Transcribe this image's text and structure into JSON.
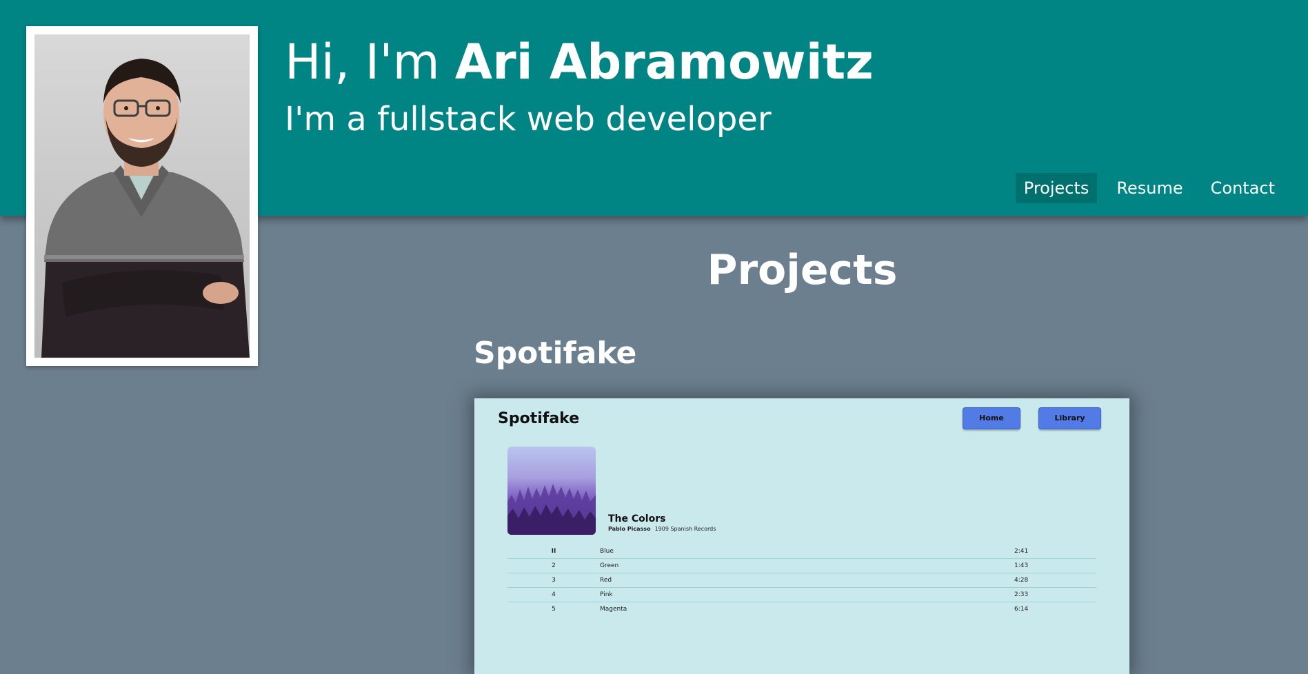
{
  "header": {
    "greeting_prefix": "Hi, I'm ",
    "name": "Ari Abramowitz",
    "tagline": "I'm a fullstack web developer"
  },
  "nav": [
    {
      "label": "Projects",
      "active": true
    },
    {
      "label": "Resume",
      "active": false
    },
    {
      "label": "Contact",
      "active": false
    }
  ],
  "main": {
    "section_title": "Projects",
    "projects": [
      {
        "title": "Spotifake"
      }
    ]
  },
  "screenshot": {
    "app_title": "Spotifake",
    "buttons": {
      "home": "Home",
      "library": "Library"
    },
    "album": {
      "name": "The Colors",
      "artist": "Pablo Picasso",
      "year_label": "1909 Spanish Records"
    },
    "tracks": [
      {
        "num": "II",
        "name": "Blue",
        "duration": "2:41"
      },
      {
        "num": "2",
        "name": "Green",
        "duration": "1:43"
      },
      {
        "num": "3",
        "name": "Red",
        "duration": "4:28"
      },
      {
        "num": "4",
        "name": "Pink",
        "duration": "2:33"
      },
      {
        "num": "5",
        "name": "Magenta",
        "duration": "6:14"
      }
    ]
  },
  "colors": {
    "header_bg": "#008484",
    "page_bg": "#6c7f8e",
    "nav_active_bg": "#00706f",
    "shot_bg": "#cae9ec",
    "shot_button": "#537be6"
  }
}
